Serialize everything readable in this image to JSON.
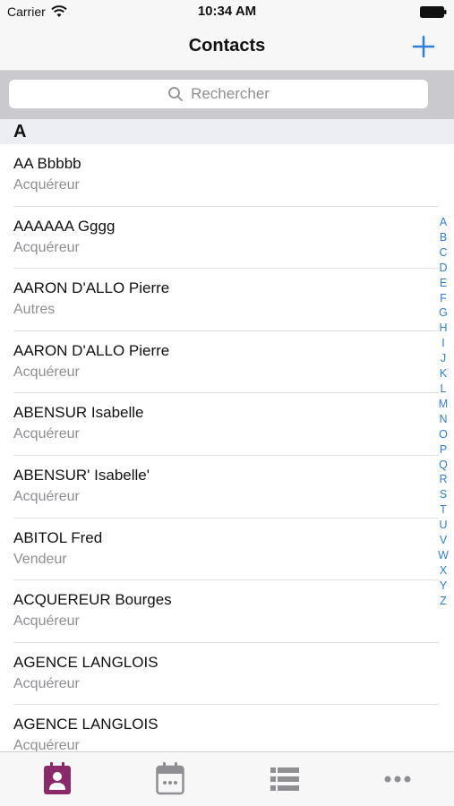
{
  "status_bar": {
    "carrier": "Carrier",
    "time": "10:34 AM"
  },
  "nav": {
    "title": "Contacts"
  },
  "search": {
    "placeholder": "Rechercher"
  },
  "section": {
    "letter": "A"
  },
  "contacts": [
    {
      "name": "AA Bbbbb",
      "role": "Acquéreur"
    },
    {
      "name": "AAAAAA Gggg",
      "role": "Acquéreur"
    },
    {
      "name": "AARON D'ALLO Pierre",
      "role": "Autres"
    },
    {
      "name": "AARON D'ALLO Pierre",
      "role": "Acquéreur"
    },
    {
      "name": "ABENSUR Isabelle",
      "role": "Acquéreur"
    },
    {
      "name": "ABENSUR' Isabelle'",
      "role": "Acquéreur"
    },
    {
      "name": "ABITOL Fred",
      "role": "Vendeur"
    },
    {
      "name": "ACQUEREUR Bourges",
      "role": "Acquéreur"
    },
    {
      "name": "AGENCE LANGLOIS",
      "role": "Acquéreur"
    },
    {
      "name": "AGENCE LANGLOIS",
      "role": "Acquéreur"
    }
  ],
  "alphabet": [
    "A",
    "B",
    "C",
    "D",
    "E",
    "F",
    "G",
    "H",
    "I",
    "J",
    "K",
    "L",
    "M",
    "N",
    "O",
    "P",
    "Q",
    "R",
    "S",
    "T",
    "U",
    "V",
    "W",
    "X",
    "Y",
    "Z"
  ],
  "tabs": [
    {
      "icon": "contacts-icon",
      "active": true
    },
    {
      "icon": "calendar-icon",
      "active": false
    },
    {
      "icon": "list-icon",
      "active": false
    },
    {
      "icon": "more-icon",
      "active": false
    }
  ],
  "colors": {
    "accent": "#2f7fd8",
    "active_tab": "#8b2a6b",
    "inactive_tab": "#8e8e93"
  }
}
